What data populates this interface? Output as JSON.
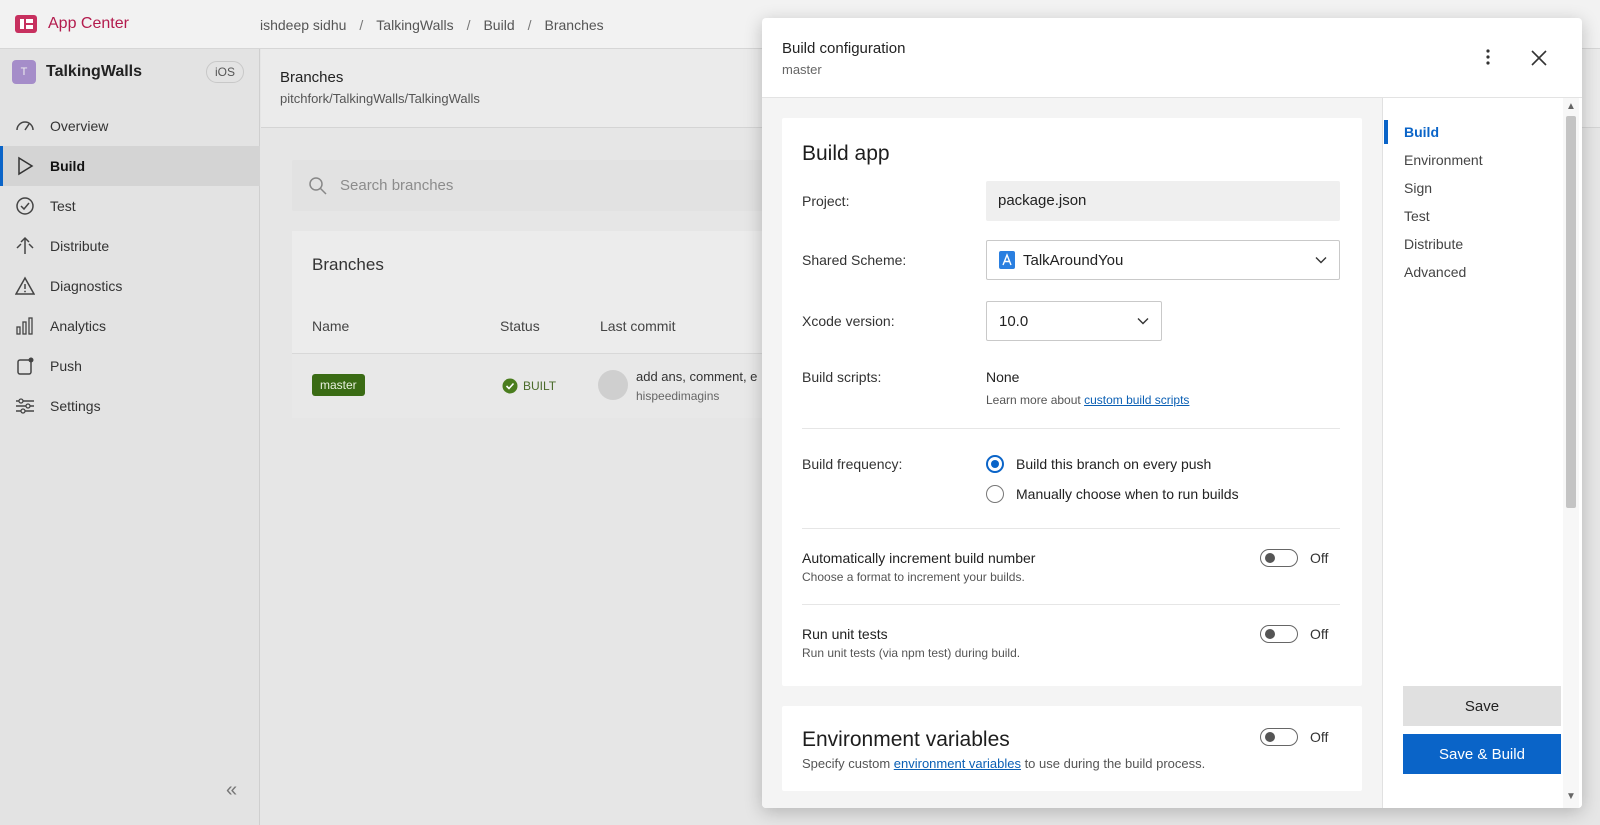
{
  "topbar": {
    "brand": "App Center",
    "breadcrumbs": [
      "ishdeep sidhu",
      "TalkingWalls",
      "Build",
      "Branches"
    ]
  },
  "sidebar": {
    "app_initial": "T",
    "app_name": "TalkingWalls",
    "os": "iOS",
    "items": [
      {
        "label": "Overview",
        "icon": "gauge-icon"
      },
      {
        "label": "Build",
        "icon": "play-icon"
      },
      {
        "label": "Test",
        "icon": "check-circle-icon"
      },
      {
        "label": "Distribute",
        "icon": "distribute-icon"
      },
      {
        "label": "Diagnostics",
        "icon": "warning-icon"
      },
      {
        "label": "Analytics",
        "icon": "bar-chart-icon"
      },
      {
        "label": "Push",
        "icon": "push-icon"
      },
      {
        "label": "Settings",
        "icon": "sliders-icon"
      }
    ],
    "active": "Build",
    "collapse_glyph": "«"
  },
  "main": {
    "title": "Branches",
    "subtitle": "pitchfork/TalkingWalls/TalkingWalls",
    "search_placeholder": "Search branches",
    "card_title": "Branches",
    "columns": [
      "Name",
      "Status",
      "Last commit"
    ],
    "row": {
      "branch": "master",
      "status": "BUILT",
      "commit_message": "add ans, comment, e",
      "commit_author": "hispeedimagins"
    }
  },
  "panel": {
    "title": "Build configuration",
    "subtitle": "master",
    "build_app": {
      "title": "Build app",
      "project_label": "Project:",
      "project_value": "package.json",
      "scheme_label": "Shared Scheme:",
      "scheme_value": "TalkAroundYou",
      "xcode_label": "Xcode version:",
      "xcode_value": "10.0",
      "scripts_label": "Build scripts:",
      "scripts_value": "None",
      "scripts_help_prefix": "Learn more about ",
      "scripts_help_link": "custom build scripts",
      "frequency_label": "Build frequency:",
      "frequency_options": [
        "Build this branch on every push",
        "Manually choose when to run builds"
      ],
      "frequency_selected": 0,
      "auto_increment_title": "Automatically increment build number",
      "auto_increment_desc": "Choose a format to increment your builds.",
      "auto_increment_state": "Off",
      "unit_tests_title": "Run unit tests",
      "unit_tests_desc": "Run unit tests (via npm test) during build.",
      "unit_tests_state": "Off"
    },
    "env": {
      "title": "Environment variables",
      "desc_prefix": "Specify custom ",
      "desc_link": "environment variables",
      "desc_suffix": " to use during the build process.",
      "state": "Off"
    },
    "side_nav": [
      "Build",
      "Environment",
      "Sign",
      "Test",
      "Distribute",
      "Advanced"
    ],
    "side_nav_active": "Build",
    "save_label": "Save",
    "save_build_label": "Save & Build"
  },
  "colors": {
    "brand": "#b31b4d",
    "accent": "#0a64c8",
    "branch_tag": "#3a6b14"
  }
}
